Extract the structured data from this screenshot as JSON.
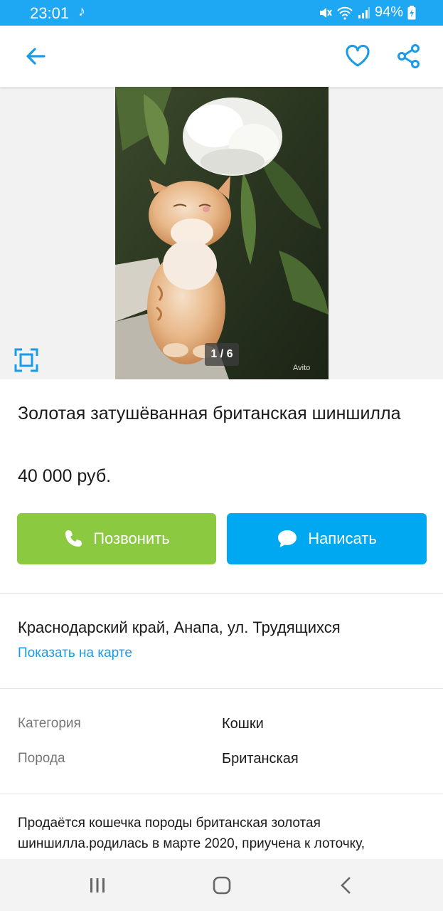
{
  "status_bar": {
    "time": "23:01",
    "music_icon": "music-note-icon",
    "battery": "94%"
  },
  "app_bar": {
    "back_icon": "arrow-left-icon",
    "favorite_icon": "heart-icon",
    "share_icon": "share-icon"
  },
  "gallery": {
    "counter": "1 / 6",
    "watermark": "Avito",
    "fullscreen_icon": "fullscreen-icon"
  },
  "listing": {
    "title": "Золотая затушёванная британская шиншилла",
    "price": "40 000 руб."
  },
  "actions": {
    "call_label": "Позвонить",
    "write_label": "Написать"
  },
  "location": {
    "address": "Краснодарский край, Анапа, ул. Трудящихся",
    "map_link": "Показать на карте"
  },
  "params": [
    {
      "label": "Категория",
      "value": "Кошки"
    },
    {
      "label": "Порода",
      "value": "Британская"
    }
  ],
  "description": "Продаётся кошечка породы британская золотая шиншилла.родилась в марте 2020, приучена к лоточку,",
  "colors": {
    "accent": "#1ea7f2",
    "call_button": "#8bc940",
    "write_button": "#00a8f2",
    "link": "#1a9be8"
  }
}
